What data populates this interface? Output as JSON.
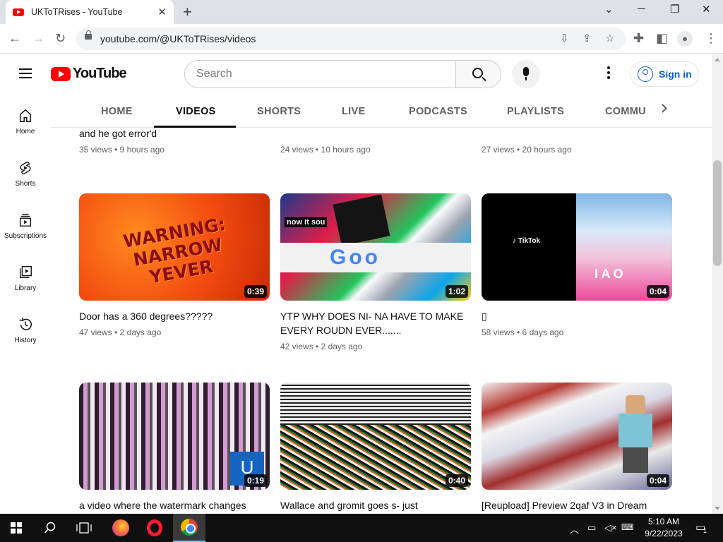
{
  "browser": {
    "tab_title": "UKToTRises - YouTube",
    "url": "youtube.com/@UKToTRises/videos"
  },
  "youtube": {
    "logo_text": "YouTube",
    "search_placeholder": "Search",
    "sign_in": "Sign in",
    "guide": [
      {
        "label": "Home",
        "icon": "home-icon"
      },
      {
        "label": "Shorts",
        "icon": "shorts-icon"
      },
      {
        "label": "Subscriptions",
        "icon": "subscriptions-icon"
      },
      {
        "label": "Library",
        "icon": "library-icon"
      },
      {
        "label": "History",
        "icon": "history-icon"
      }
    ],
    "tabs": [
      "HOME",
      "VIDEOS",
      "SHORTS",
      "LIVE",
      "PODCASTS",
      "PLAYLISTS",
      "COMMU"
    ],
    "active_tab": "VIDEOS",
    "top_row": [
      {
        "title": "and he got error'd",
        "meta": "35 views • 9 hours ago"
      },
      {
        "title": "",
        "meta": "24 views • 10 hours ago"
      },
      {
        "title": "",
        "meta": "27 views • 20 hours ago"
      }
    ],
    "videos": [
      {
        "title": "Door has a 360 degrees?????",
        "meta": "47 views • 2 days ago",
        "duration": "0:39",
        "thumb_text": "WARNING: NARROW YEVER"
      },
      {
        "title": "YTP WHY DOES NI- NA HAVE TO MAKE EVERY ROUDN EVER.......",
        "meta": "42 views • 2 days ago",
        "duration": "1:02",
        "thumb_text": "now it sou"
      },
      {
        "title": "▯",
        "meta": "58 views • 6 days ago",
        "duration": "0:04",
        "thumb_text": "I A O"
      },
      {
        "title": "a video where the watermark changes",
        "meta": "",
        "duration": "0:19",
        "thumb_text": "U"
      },
      {
        "title": "Wallace and gromit goes s- just",
        "meta": "",
        "duration": "0:40",
        "thumb_text": ""
      },
      {
        "title": "[Reupload] Preview 2qaf V3 in Dream",
        "meta": "",
        "duration": "0:04",
        "thumb_text": ""
      }
    ]
  },
  "taskbar": {
    "time": "5:10 AM",
    "date": "9/22/2023",
    "notification_count": "1"
  },
  "colors": {
    "youtube_red": "#ff0000",
    "link_blue": "#065fd4",
    "taskbar": "#101010"
  }
}
